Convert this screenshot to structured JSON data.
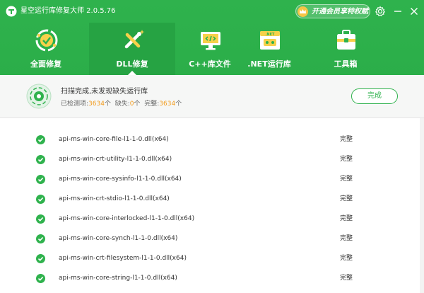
{
  "app": {
    "title": "星空运行库修复大师 2.0.5.76",
    "vip_label": "开通会员享特权赋"
  },
  "nav": {
    "items": [
      {
        "label": "全面修复",
        "icon": "full-repair-icon"
      },
      {
        "label": "DLL修复",
        "icon": "dll-repair-icon",
        "active": true
      },
      {
        "label": "C++库文件",
        "icon": "cpp-library-icon"
      },
      {
        "label": ".NET运行库",
        "icon": "dotnet-runtime-icon"
      },
      {
        "label": "工具箱",
        "icon": "toolbox-icon"
      }
    ]
  },
  "status": {
    "title": "扫描完成,未发现缺失运行库",
    "detected_label": "已检测项:",
    "detected_value": "3634",
    "detected_unit": "个",
    "missing_label": "缺失:",
    "missing_value": "0",
    "missing_unit": "个",
    "complete_label": "完整:",
    "complete_value": "3634",
    "complete_unit": "个",
    "done_button": "完成"
  },
  "list": {
    "rows": [
      {
        "name": "api-ms-win-core-file-l1-1-0.dll(x64)",
        "status": "完整"
      },
      {
        "name": "api-ms-win-crt-utility-l1-1-0.dll(x64)",
        "status": "完整"
      },
      {
        "name": "api-ms-win-core-sysinfo-l1-1-0.dll(x64)",
        "status": "完整"
      },
      {
        "name": "api-ms-win-crt-stdio-l1-1-0.dll(x64)",
        "status": "完整"
      },
      {
        "name": "api-ms-win-core-interlocked-l1-1-0.dll(x64)",
        "status": "完整"
      },
      {
        "name": "api-ms-win-core-synch-l1-1-0.dll(x64)",
        "status": "完整"
      },
      {
        "name": "api-ms-win-crt-filesystem-l1-1-0.dll(x64)",
        "status": "完整"
      },
      {
        "name": "api-ms-win-core-string-l1-1-0.dll(x64)",
        "status": "完整"
      }
    ]
  },
  "colors": {
    "brand_green": "#2fb24d",
    "active_tab": "#26a343",
    "count_orange": "#f29b1b",
    "vip_gold": "#f6c545"
  }
}
